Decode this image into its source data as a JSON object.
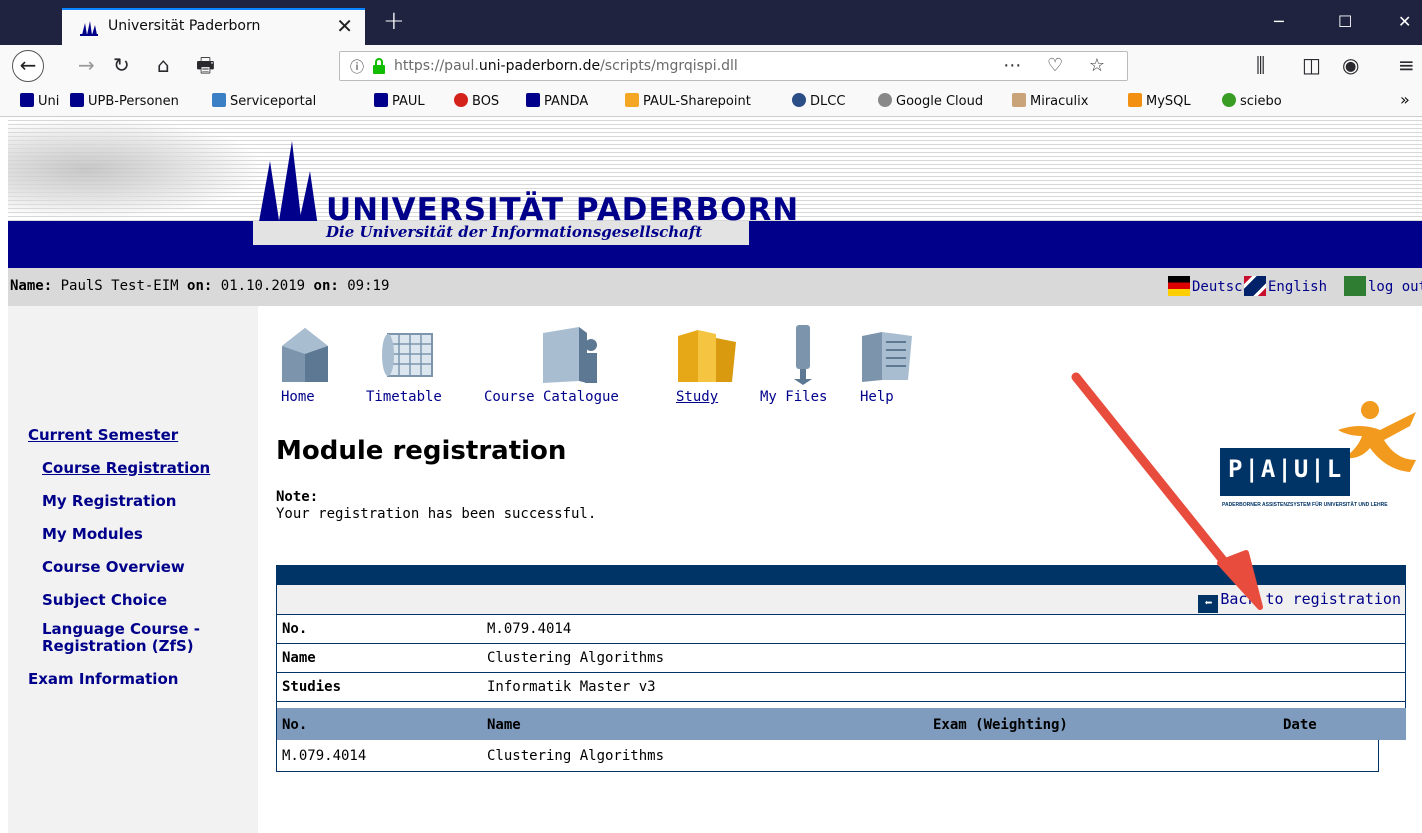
{
  "browser": {
    "tab_title": "Universität Paderborn",
    "tab_close": "✕",
    "new_tab": "+",
    "url_prefix": "https://paul.",
    "url_host": "uni-paderborn.de",
    "url_path": "/scripts/mgrqispi.dll",
    "bookmarks": [
      "Uni",
      "UPB-Personen",
      "Serviceportal",
      "PAUL",
      "BOS",
      "PANDA",
      "PAUL-Sharepoint",
      "DLCC",
      "Google Cloud",
      "Miraculix",
      "MySQL",
      "sciebo"
    ],
    "bookmarks_overflow": "»"
  },
  "banner": {
    "university": "UNIVERSITÄT PADERBORN",
    "subtitle": "Die Universität der Informationsgesellschaft"
  },
  "infobar": {
    "name_label": "Name:",
    "name_value": "PaulS Test-EIM",
    "on_label_1": "on:",
    "date": "01.10.2019",
    "on_label_2": "on:",
    "time": "09:19",
    "lang_de": "Deutsch",
    "lang_en": "English",
    "logout": "log out"
  },
  "sidebar": {
    "items": [
      "Current Semester",
      "Course Registration",
      "My Registration",
      "My Modules",
      "Course Overview",
      "Subject Choice",
      "Language Course -",
      "Registration (ZfS)",
      "Exam Information"
    ]
  },
  "menu": {
    "items": [
      "Home",
      "Timetable",
      "Course Catalogue",
      "Study",
      "My Files",
      "Help"
    ]
  },
  "logo_letters": [
    "P",
    "A",
    "U",
    "L"
  ],
  "logo_tagline": "Paderborner Assistenzsystem für Universität und Lehre",
  "content": {
    "title": "Module registration",
    "note_label": "Note:",
    "note_text": "Your registration has been successful.",
    "back_link": "Back to registration",
    "back_icon": "⬅",
    "details": [
      {
        "key": "No.",
        "value": "M.079.4014"
      },
      {
        "key": "Name",
        "value": "Clustering Algorithms"
      },
      {
        "key": "Studies",
        "value": "Informatik Master v3"
      }
    ],
    "columns": [
      "No.",
      "Name",
      "Exam (Weighting)",
      "Date"
    ],
    "rows": [
      {
        "no": "M.079.4014",
        "name": "Clustering Algorithms",
        "exam": "",
        "date": ""
      }
    ]
  },
  "colors": {
    "navy": "#00008b",
    "header_blue": "#003366",
    "column_header": "#7f9bbd",
    "annotation_arrow": "#e84c3d"
  }
}
